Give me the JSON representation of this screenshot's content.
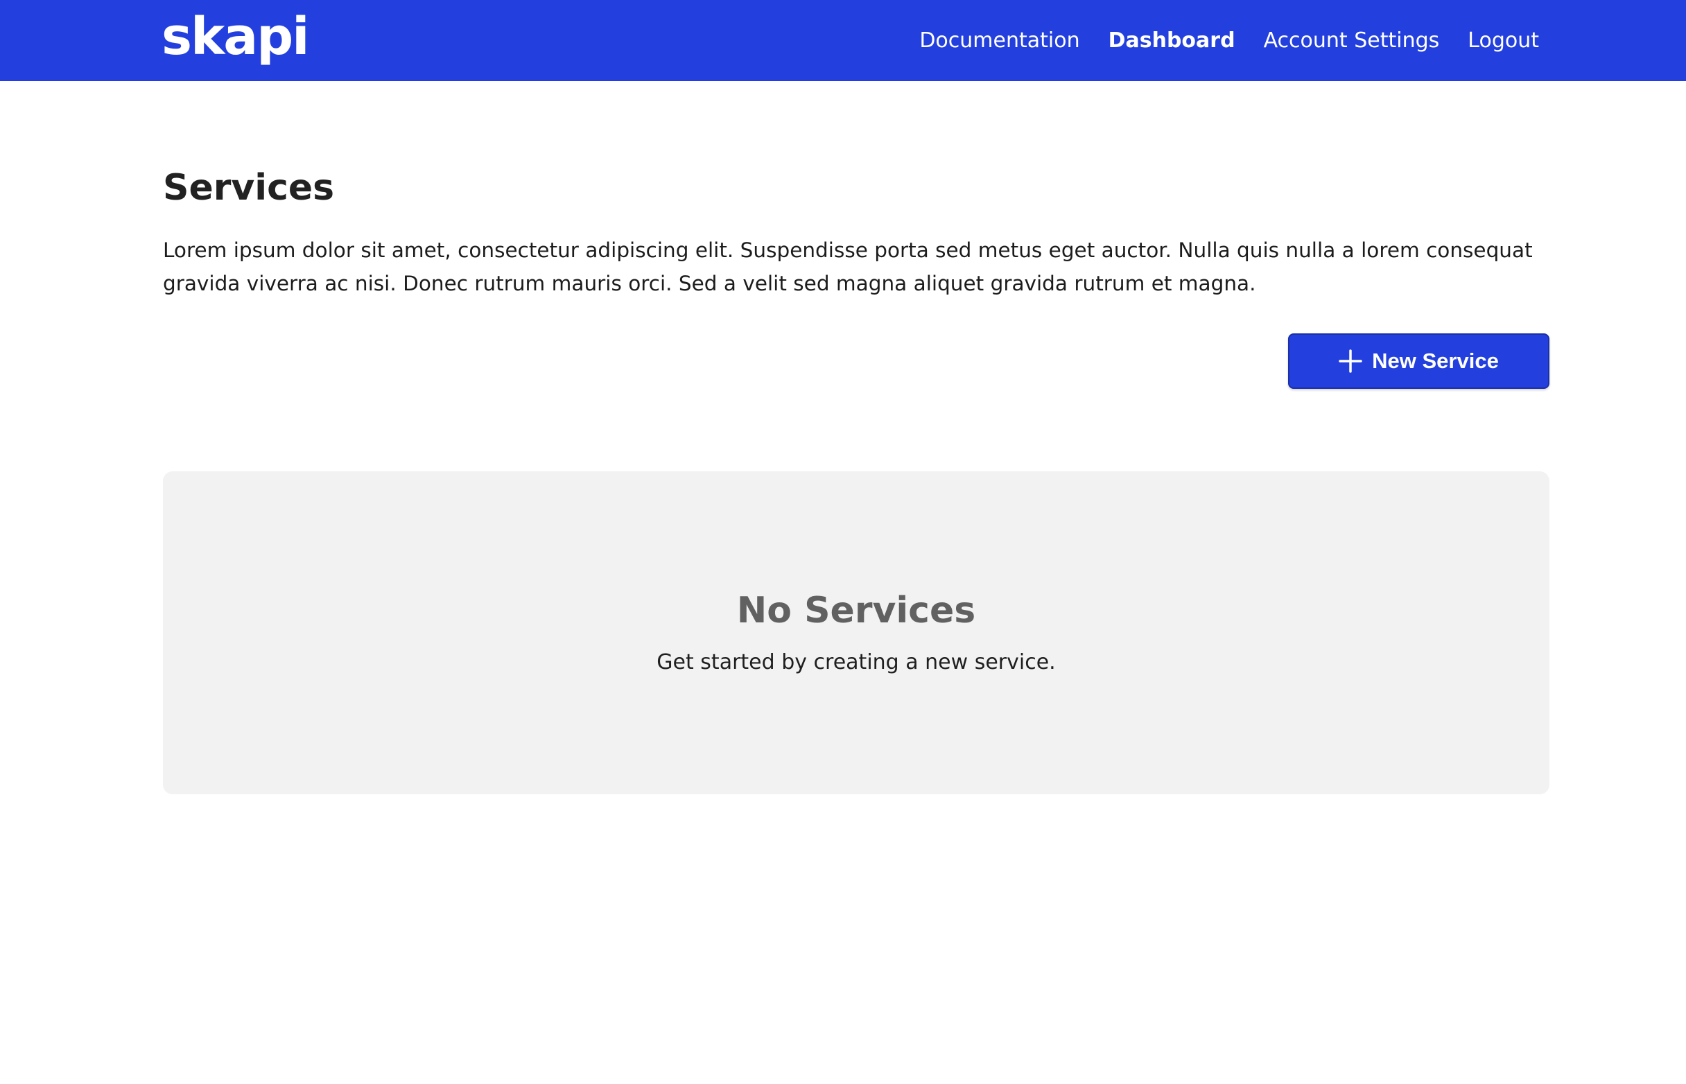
{
  "brand": {
    "logo_text": "skapi"
  },
  "nav": {
    "items": [
      {
        "label": "Documentation",
        "active": false
      },
      {
        "label": "Dashboard",
        "active": true
      },
      {
        "label": "Account Settings",
        "active": false
      },
      {
        "label": "Logout",
        "active": false
      }
    ]
  },
  "page": {
    "title": "Services",
    "description": "Lorem ipsum dolor sit amet, consectetur adipiscing elit. Suspendisse porta sed metus eget auctor. Nulla quis nulla a lorem consequat gravida viverra ac nisi. Donec rutrum mauris orci. Sed a velit sed magna aliquet gravida rutrum et magna."
  },
  "actions": {
    "new_service_label": "New Service",
    "new_service_icon": "plus-icon"
  },
  "empty_state": {
    "title": "No Services",
    "subtitle": "Get started by creating a new service."
  },
  "colors": {
    "brand_blue": "#2340de",
    "empty_bg": "#f2f2f2",
    "empty_title": "#616161"
  }
}
